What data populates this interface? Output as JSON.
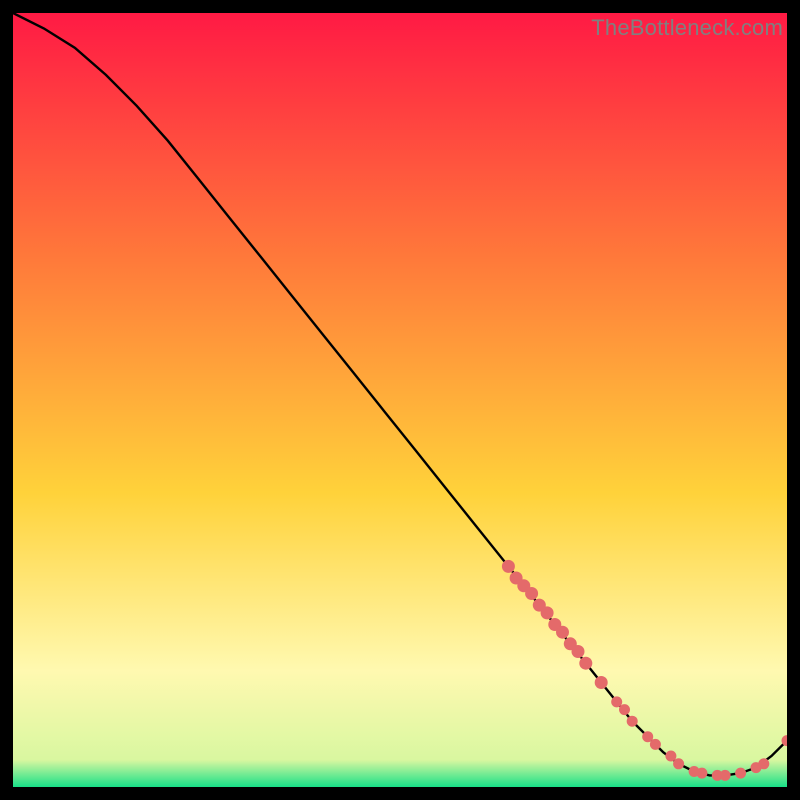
{
  "attribution": "TheBottleneck.com",
  "colors": {
    "grad_top": "#ff1a44",
    "grad_mid1": "#ff7a3a",
    "grad_mid2": "#ffd23a",
    "grad_mid3": "#fff06a",
    "grad_bot": "#18e088",
    "curve": "#000000",
    "point": "#e46a6a",
    "frame": "#000000"
  },
  "chart_data": {
    "type": "line",
    "title": "",
    "xlabel": "",
    "ylabel": "",
    "xlim": [
      0,
      100
    ],
    "ylim": [
      0,
      100
    ],
    "grid": false,
    "series": [
      {
        "name": "bottleneck-curve",
        "x": [
          0,
          4,
          8,
          12,
          16,
          20,
          24,
          28,
          32,
          36,
          40,
          44,
          48,
          52,
          56,
          60,
          64,
          68,
          72,
          76,
          80,
          82,
          84,
          86,
          88,
          90,
          92,
          94,
          96,
          98,
          100
        ],
        "y": [
          100,
          98,
          95.5,
          92,
          88,
          83.5,
          78.5,
          73.5,
          68.5,
          63.5,
          58.5,
          53.5,
          48.5,
          43.5,
          38.5,
          33.5,
          28.5,
          23.5,
          18.5,
          13.5,
          8.5,
          6.5,
          4.5,
          3,
          2,
          1.5,
          1.5,
          1.8,
          2.5,
          4,
          6
        ]
      }
    ],
    "points": {
      "name": "highlighted-points",
      "x": [
        64,
        65,
        66,
        67,
        68,
        69,
        70,
        71,
        72,
        73,
        74,
        76,
        78,
        79,
        80,
        82,
        83,
        85,
        86,
        88,
        89,
        91,
        92,
        94,
        96,
        97,
        100
      ],
      "y": [
        28.5,
        27,
        26,
        25,
        23.5,
        22.5,
        21,
        20,
        18.5,
        17.5,
        16,
        13.5,
        11,
        10,
        8.5,
        6.5,
        5.5,
        4,
        3,
        2,
        1.8,
        1.5,
        1.5,
        1.8,
        2.5,
        3,
        6
      ]
    }
  }
}
